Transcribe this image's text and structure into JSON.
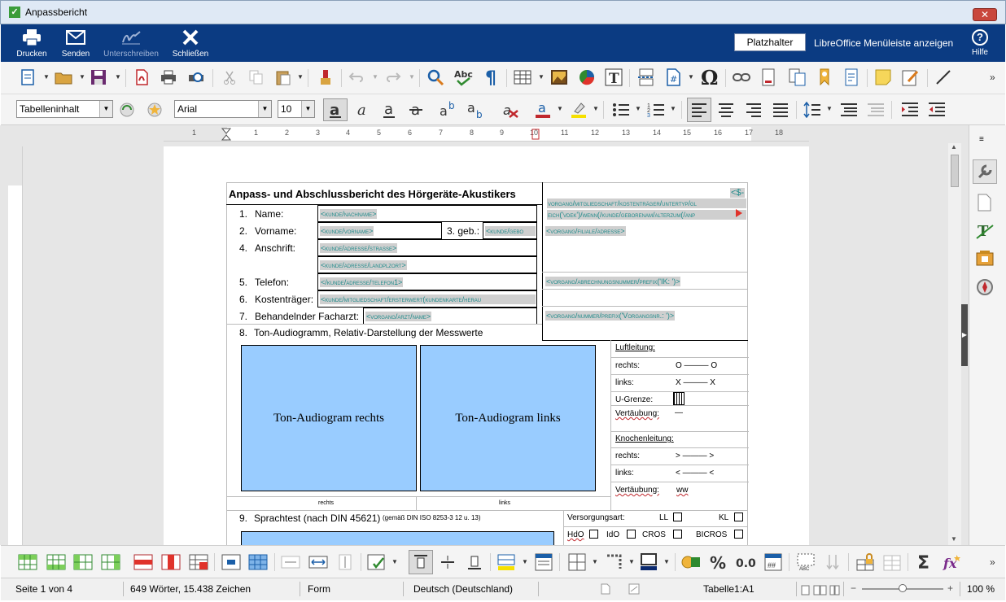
{
  "window": {
    "title": "Anpassbericht",
    "close": "✕"
  },
  "actions": {
    "print": "Drucken",
    "send": "Senden",
    "sign": "Unterschreiben",
    "close": "Schließen",
    "placeholder": "Platzhalter",
    "show_menu": "LibreOffice Menüleiste anzeigen",
    "help": "Hilfe"
  },
  "format": {
    "style": "Tabelleninhalt",
    "font": "Arial",
    "size": "10"
  },
  "ruler": {
    "ticks": [
      "1",
      "1",
      "2",
      "3",
      "4",
      "5",
      "6",
      "7",
      "8",
      "9",
      "10",
      "11",
      "12",
      "13",
      "14",
      "15",
      "16",
      "17",
      "18"
    ]
  },
  "document": {
    "title": "Anpass- und Abschlussbericht des Hörgeräte-Akustikers",
    "rows": [
      {
        "num": "1.",
        "label": "Name:",
        "field": "<kunde/nachname>"
      },
      {
        "num": "2.",
        "label": "Vorname:",
        "field": "<kunde/vorname>"
      },
      {
        "num": "4.",
        "label": "Anschrift:",
        "field": "<kunde/adresse/strasse>"
      },
      {
        "num": "",
        "label": "",
        "field": "<kunde/adresse/landplzort>"
      },
      {
        "num": "5.",
        "label": "Telefon:",
        "field": "</kunde/adresse/telefon1>"
      },
      {
        "num": "6.",
        "label": "Kostenträger:",
        "field": "<kunde/mitgliedschaft/ersterwert(kundenkarte/herau"
      },
      {
        "num": "7.",
        "label": "Behandelnder Facharzt:",
        "field": "<vorgang/arzt/name>"
      },
      {
        "num": "8.",
        "label": "Ton-Audiogramm, Relativ-Darstellung der Messwerte",
        "field": ""
      }
    ],
    "geb_label": "3. geb.:",
    "geb_field": "<kunde/gebo",
    "right_fields": {
      "dollar": "<$-",
      "line1": "vorgang/mitgliedschaft/kostenträger/untertyp/gl",
      "line2": "eich('vdek')/wenn(/kunde/geborenam/alterzum(/anp",
      "filiale": "<vorgang/filiale/adresse>",
      "abrechnung": "<vorgang/abrechnungsnummer/prefix('IK: ')>",
      "vorgangsnr": "<vorgang/nummer/prefix('Vorgangsnr.: ')>"
    },
    "audiogram_right": "Ton-Audiogram rechts",
    "audiogram_left": "Ton-Audiogram links",
    "caption_right": "rechts",
    "caption_left": "links",
    "legend": {
      "air_title": "Luftleitung:",
      "air_right": "rechts:",
      "air_right_sym": "O ——— O",
      "air_left": "links:",
      "air_left_sym": "X ——— X",
      "ugrenze": "U-Grenze:",
      "vertaeubung": "Vertäubung:",
      "vert_sym": "—",
      "bone_title": "Knochenleitung:",
      "bone_right": "rechts:",
      "bone_right_sym": "> ——— >",
      "bone_left": "links:",
      "bone_left_sym": "< ——— <",
      "bone_vert": "Vertäubung:",
      "bone_vert_sym": "ww"
    },
    "row9": {
      "num": "9.",
      "label": "Sprachtest (nach DIN 45621)",
      "small": "(gemäß DIN ISO 8253-3 12 u. 13)",
      "versorgung": "Versorgungsart:",
      "ll": "LL",
      "kl": "KL",
      "hdo": "HdO",
      "ido": "IdO",
      "cros": "CROS",
      "bicros": "BICROS"
    }
  },
  "status": {
    "page": "Seite 1 von 4",
    "words": "649 Wörter, 15.438 Zeichen",
    "style": "Form",
    "language": "Deutsch (Deutschland)",
    "table": "Tabelle1:A1",
    "zoom": "100 %"
  }
}
